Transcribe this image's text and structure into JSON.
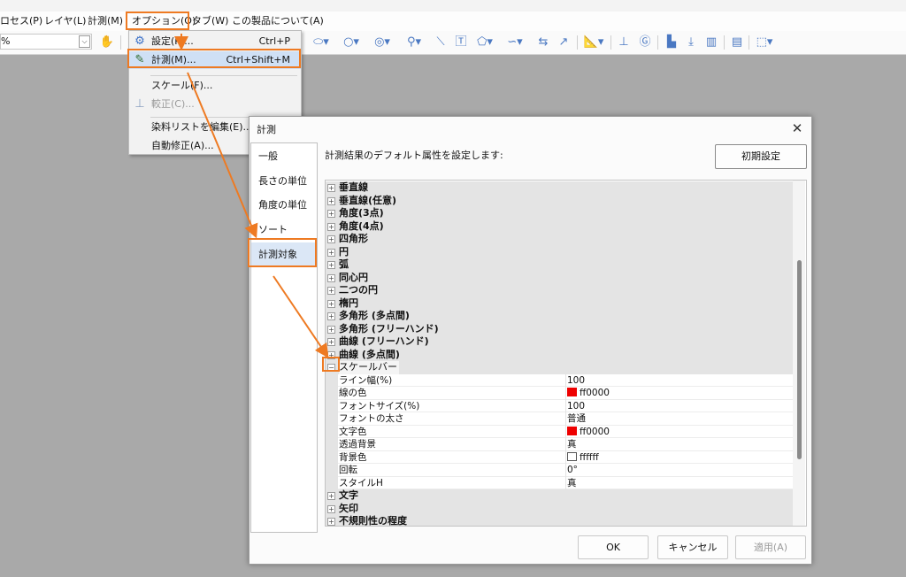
{
  "menubar": {
    "items": [
      {
        "label": "ロセス(P)"
      },
      {
        "label": "レイヤ(L)"
      },
      {
        "label": "計測(M)"
      },
      {
        "label": "オプション(O)"
      },
      {
        "label": "タブ(W)"
      },
      {
        "label": "この製品について(A)"
      }
    ]
  },
  "toolbar": {
    "zoom_value": "%",
    "icons": [
      "hand-icon",
      "ellipse-icon",
      "circle-icon",
      "concentric-icon",
      "link-icon",
      "line-icon",
      "text-icon",
      "pentagon-icon",
      "wave-icon",
      "dimension-icon",
      "arrow-icon",
      "angle-icon",
      "scale-icon",
      "g-icon",
      "chart-icon",
      "align-icon",
      "ruler-icon",
      "doc-icon",
      "export-icon"
    ]
  },
  "dropdown": {
    "items": [
      {
        "icon": "gear-icon",
        "label": "設定(P)...",
        "shortcut": "Ctrl+P",
        "disabled": false
      },
      {
        "icon": "pen-icon",
        "label": "計測(M)...",
        "shortcut": "Ctrl+Shift+M",
        "disabled": false
      },
      {
        "icon": "",
        "label": "スケール(F)...",
        "shortcut": "",
        "disabled": false
      },
      {
        "icon": "calibrate-icon",
        "label": "較正(C)...",
        "shortcut": "",
        "disabled": true
      },
      {
        "icon": "",
        "label": "染料リストを編集(E)...",
        "shortcut": "",
        "disabled": false
      },
      {
        "icon": "",
        "label": "自動修正(A)...",
        "shortcut": "",
        "disabled": false
      }
    ]
  },
  "dialog": {
    "title": "計測",
    "close": "✕",
    "nav": [
      "一般",
      "長さの単位",
      "角度の単位",
      "ソート",
      "計測対象"
    ],
    "selected_nav": "計測対象",
    "description": "計測結果のデフォルト属性を設定します:",
    "reset_button": "初期設定",
    "tree_before": [
      "垂直線",
      "垂直線(任意)",
      "角度(3点)",
      "角度(4点)",
      "四角形",
      "円",
      "弧",
      "同心円",
      "二つの円",
      "楕円",
      "多角形 (多点間)",
      "多角形 (フリーハンド)",
      "曲線 (フリーハンド)",
      "曲線 (多点間)"
    ],
    "expanded_category": "スケールバー",
    "properties": [
      {
        "name": "ライン幅(%)",
        "value": "100"
      },
      {
        "name": "線の色",
        "value": "ff0000",
        "swatch": "#ee0000"
      },
      {
        "name": "フォントサイズ(%)",
        "value": "100"
      },
      {
        "name": "フォントの太さ",
        "value": "普通"
      },
      {
        "name": "文字色",
        "value": "ff0000",
        "swatch": "#ee0000"
      },
      {
        "name": "透過背景",
        "value": "真"
      },
      {
        "name": "背景色",
        "value": "ffffff",
        "swatch": "#ffffff"
      },
      {
        "name": "回転",
        "value": "0°"
      },
      {
        "name": "スタイルH",
        "value": "真"
      }
    ],
    "tree_after": [
      "文字",
      "矢印",
      "不規則性の程度"
    ],
    "buttons": {
      "ok": "OK",
      "cancel": "キャンセル",
      "apply": "適用(A)"
    }
  },
  "colors": {
    "highlight": "#ee7a22",
    "selection": "#dbe7f6",
    "swatch_red": "#ee0000"
  }
}
